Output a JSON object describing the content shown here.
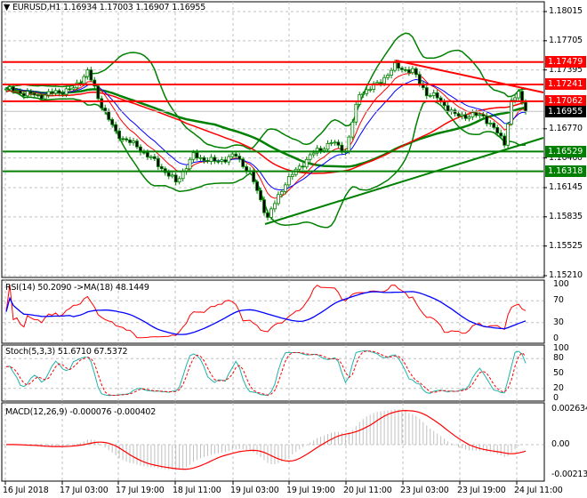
{
  "header": {
    "symbol": "EURUSD,H1",
    "open": "1.16934",
    "high": "1.17003",
    "low": "1.16907",
    "close": "1.16955"
  },
  "price_axis": [
    "1.18015",
    "1.17705",
    "1.17395",
    "1.16770",
    "1.16460",
    "1.16145",
    "1.15835",
    "1.15525",
    "1.15210"
  ],
  "price_tags": [
    {
      "label": "1.17479",
      "color": "#ff0000",
      "kind": "resistance"
    },
    {
      "label": "1.17241",
      "color": "#ff0000",
      "kind": "resistance"
    },
    {
      "label": "1.17062",
      "color": "#ff0000",
      "kind": "resistance"
    },
    {
      "label": "1.16955",
      "color": "#000000",
      "kind": "current"
    },
    {
      "label": "1.16529",
      "color": "#008000",
      "kind": "support"
    },
    {
      "label": "1.16318",
      "color": "#008000",
      "kind": "support"
    }
  ],
  "rsi": {
    "label": "RSI(14) 50.2090  ->MA(18) 48.1449",
    "axis": [
      "100",
      "70",
      "30",
      "0"
    ]
  },
  "stoch": {
    "label": "Stoch(5,3,3) 51.6710 67.5372",
    "axis": [
      "100",
      "80",
      "50",
      "20",
      "0"
    ]
  },
  "macd": {
    "label": "MACD(12,26,9) -0.000076 -0.000402",
    "axis": [
      "0.002634",
      "0.00",
      "-0.00213"
    ]
  },
  "time_axis": [
    "16 Jul 2018",
    "17 Jul 03:00",
    "17 Jul 19:00",
    "18 Jul 11:00",
    "19 Jul 03:00",
    "19 Jul 19:00",
    "20 Jul 11:00",
    "23 Jul 03:00",
    "23 Jul 19:00",
    "24 Jul 11:00"
  ],
  "chart_data": {
    "type": "candlestick",
    "bars": 148,
    "keypoints": [
      [
        0,
        1.17193
      ],
      [
        9,
        1.17118
      ],
      [
        19,
        1.17193
      ],
      [
        23,
        1.17382
      ],
      [
        26,
        1.17099
      ],
      [
        31,
        1.16721
      ],
      [
        37,
        1.1658
      ],
      [
        43,
        1.16391
      ],
      [
        48,
        1.16202
      ],
      [
        53,
        1.16485
      ],
      [
        59,
        1.16419
      ],
      [
        65,
        1.16485
      ],
      [
        69,
        1.16296
      ],
      [
        74,
        1.15824
      ],
      [
        79,
        1.16202
      ],
      [
        86,
        1.16485
      ],
      [
        92,
        1.16627
      ],
      [
        96,
        1.16532
      ],
      [
        100,
        1.17146
      ],
      [
        105,
        1.17241
      ],
      [
        110,
        1.1743
      ],
      [
        115,
        1.17382
      ],
      [
        119,
        1.17146
      ],
      [
        122,
        1.17099
      ],
      [
        127,
        1.1691
      ],
      [
        135,
        1.1691
      ],
      [
        141,
        1.16627
      ],
      [
        143,
        1.17052
      ],
      [
        145,
        1.17146
      ],
      [
        147,
        1.16955
      ]
    ],
    "colors": {
      "bull": "#008000",
      "bear": "#008000",
      "bb": "#008000",
      "ma_fast": "#ff0000",
      "ma_slow": "#0000ff",
      "ma_long": "#008000"
    }
  }
}
